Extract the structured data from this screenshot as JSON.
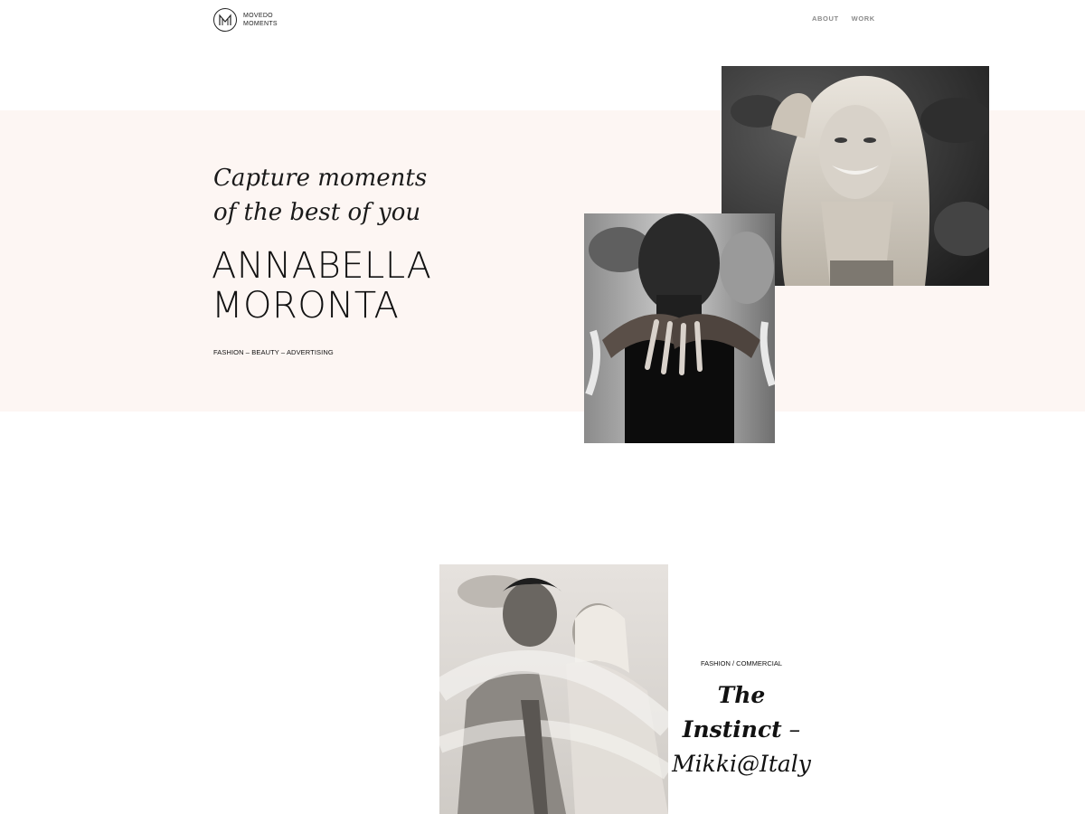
{
  "header": {
    "logo_line1": "MOVEDO",
    "logo_line2": "MOMENTS",
    "nav": [
      "ABOUT",
      "WORK"
    ]
  },
  "hero": {
    "tagline_line1": "Capture moments",
    "tagline_line2": "of the best of you",
    "name_line1": "ANNABELLA",
    "name_line2": "MORONTA",
    "categories": "FASHION – BEAUTY – ADVERTISING"
  },
  "project": {
    "category": "FASHION / COMMERCIAL",
    "title_bold": "The Instinct",
    "title_dash": " –",
    "title_line2": "Mikki@Italy"
  },
  "colors": {
    "band": "#fdf6f3",
    "nav_text": "#8a8a8a",
    "text": "#111111"
  },
  "icons": {
    "logo": "m-monogram-circle-icon"
  }
}
